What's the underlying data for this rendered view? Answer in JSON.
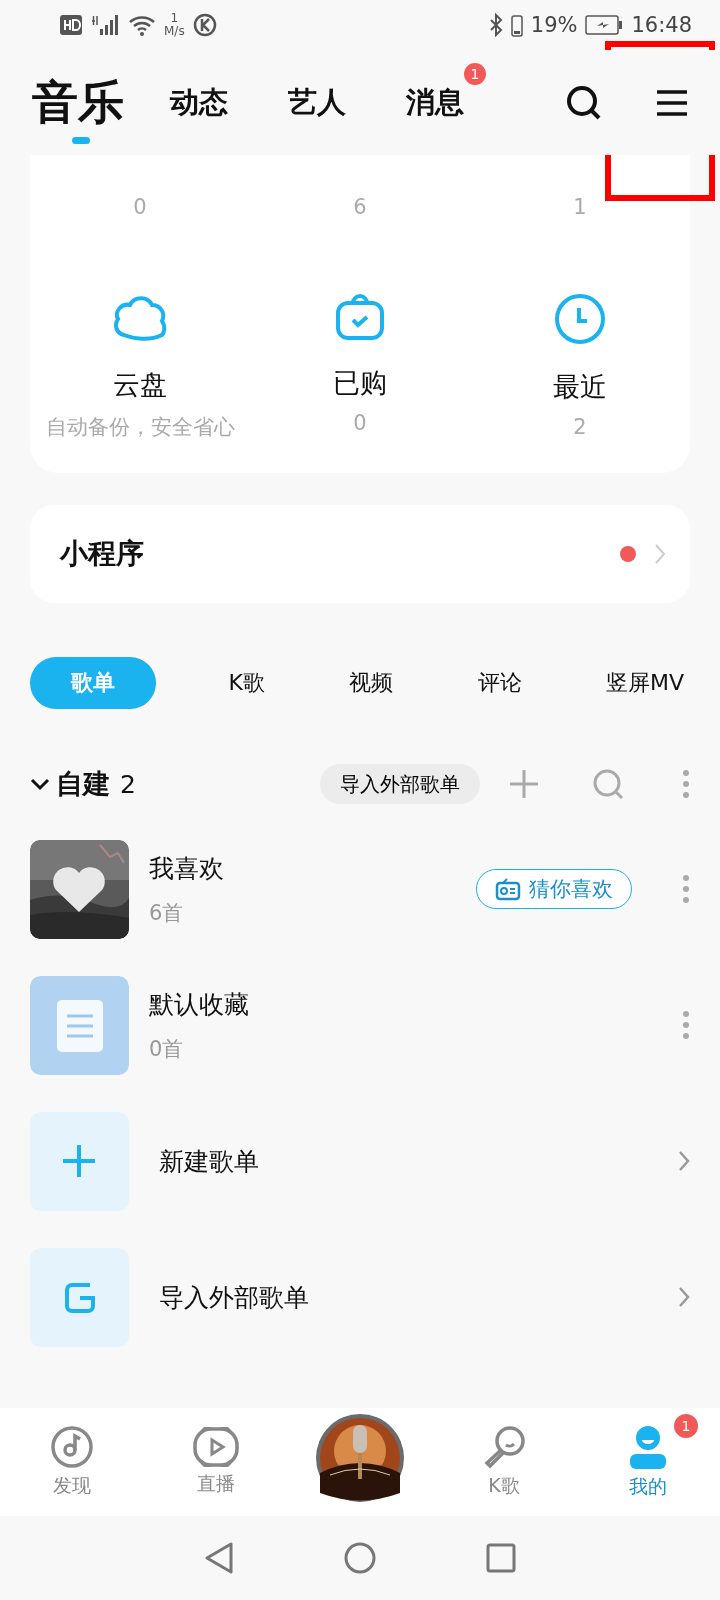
{
  "status_bar": {
    "speed_value": "1",
    "speed_unit": "M/s",
    "battery": "19%",
    "time": "16:48"
  },
  "header": {
    "tabs": [
      {
        "label": "音乐",
        "selected": true
      },
      {
        "label": "动态",
        "selected": false
      },
      {
        "label": "艺人",
        "selected": false
      },
      {
        "label": "消息",
        "selected": false,
        "badge": "1"
      }
    ]
  },
  "library": {
    "top_row": [
      {
        "count": "0"
      },
      {
        "count": "6"
      },
      {
        "count": "1"
      }
    ],
    "items": [
      {
        "kind": "cloud",
        "label": "云盘",
        "sub": "自动备份，安全省心"
      },
      {
        "kind": "bag",
        "label": "已购",
        "sub": "0"
      },
      {
        "kind": "clock",
        "label": "最近",
        "sub": "2"
      }
    ]
  },
  "mini_program": {
    "title": "小程序",
    "dot": true
  },
  "chips": [
    {
      "label": "歌单",
      "selected": true
    },
    {
      "label": "K歌",
      "selected": false
    },
    {
      "label": "视频",
      "selected": false
    },
    {
      "label": "评论",
      "selected": false
    },
    {
      "label": "竖屏MV",
      "selected": false
    }
  ],
  "section": {
    "title": "自建",
    "count": "2",
    "expanded": true,
    "import_button": "导入外部歌单"
  },
  "playlists": [
    {
      "kind": "cover",
      "title": "我喜欢",
      "sub": "6首",
      "action": "猜你喜欢"
    },
    {
      "kind": "doc",
      "title": "默认收藏",
      "sub": "0首"
    },
    {
      "kind": "add",
      "title": "新建歌单"
    },
    {
      "kind": "import",
      "title": "导入外部歌单"
    }
  ],
  "bottom_nav": [
    {
      "kind": "disc",
      "label": "发现",
      "selected": false
    },
    {
      "kind": "play",
      "label": "直播",
      "selected": false
    },
    {
      "kind": "center"
    },
    {
      "kind": "mic",
      "label": "K歌",
      "selected": false
    },
    {
      "kind": "user",
      "label": "我的",
      "selected": true,
      "badge": "1"
    }
  ]
}
